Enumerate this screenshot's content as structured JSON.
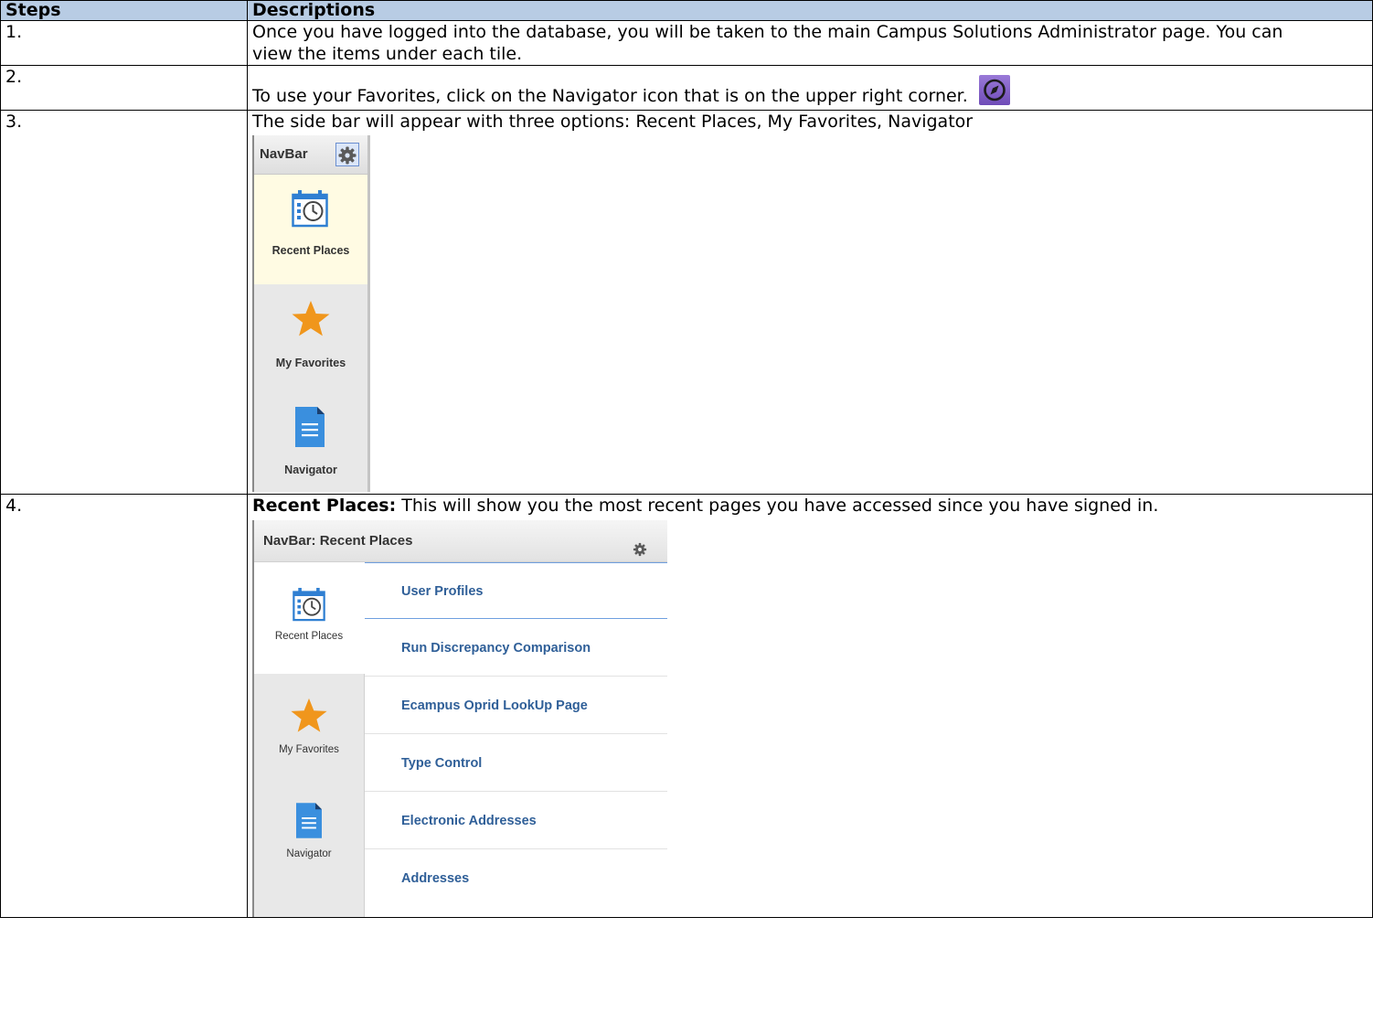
{
  "table": {
    "headers": {
      "steps": "Steps",
      "descriptions": "Descriptions"
    },
    "rows": [
      {
        "step": "1.",
        "text": "Once you have logged into the database, you will be taken to the main Campus Solutions Administrator page.  You can view the items under each tile."
      },
      {
        "step": "2.",
        "text": "To use your Favorites, click on the Navigator icon that is on the upper right corner."
      },
      {
        "step": "3.",
        "text": "The side bar will appear with three options: Recent Places, My Favorites, Navigator"
      },
      {
        "step": "4.",
        "bold": "Recent Places:",
        "text": " This will show you the most recent pages you have accessed since you have signed in."
      }
    ]
  },
  "navbar_basic": {
    "title": "NavBar",
    "items": [
      "Recent Places",
      "My Favorites",
      "Navigator"
    ]
  },
  "navbar_recent": {
    "title": "NavBar: Recent Places",
    "side_items": [
      "Recent Places",
      "My Favorites",
      "Navigator"
    ],
    "list": [
      "User Profiles",
      "Run Discrepancy Comparison",
      "Ecampus Oprid LookUp Page",
      "Type Control",
      "Electronic Addresses",
      "Addresses"
    ]
  },
  "colors": {
    "header_bg": "#b8cce4",
    "link_blue": "#2f5f98",
    "star": "#f0961c",
    "doc_blue": "#3a8fde",
    "nav_icon_purple": "#7d5cc4"
  },
  "icons": [
    "navigator-compass-icon",
    "gear-icon",
    "calendar-clock-icon",
    "star-icon",
    "document-icon"
  ]
}
